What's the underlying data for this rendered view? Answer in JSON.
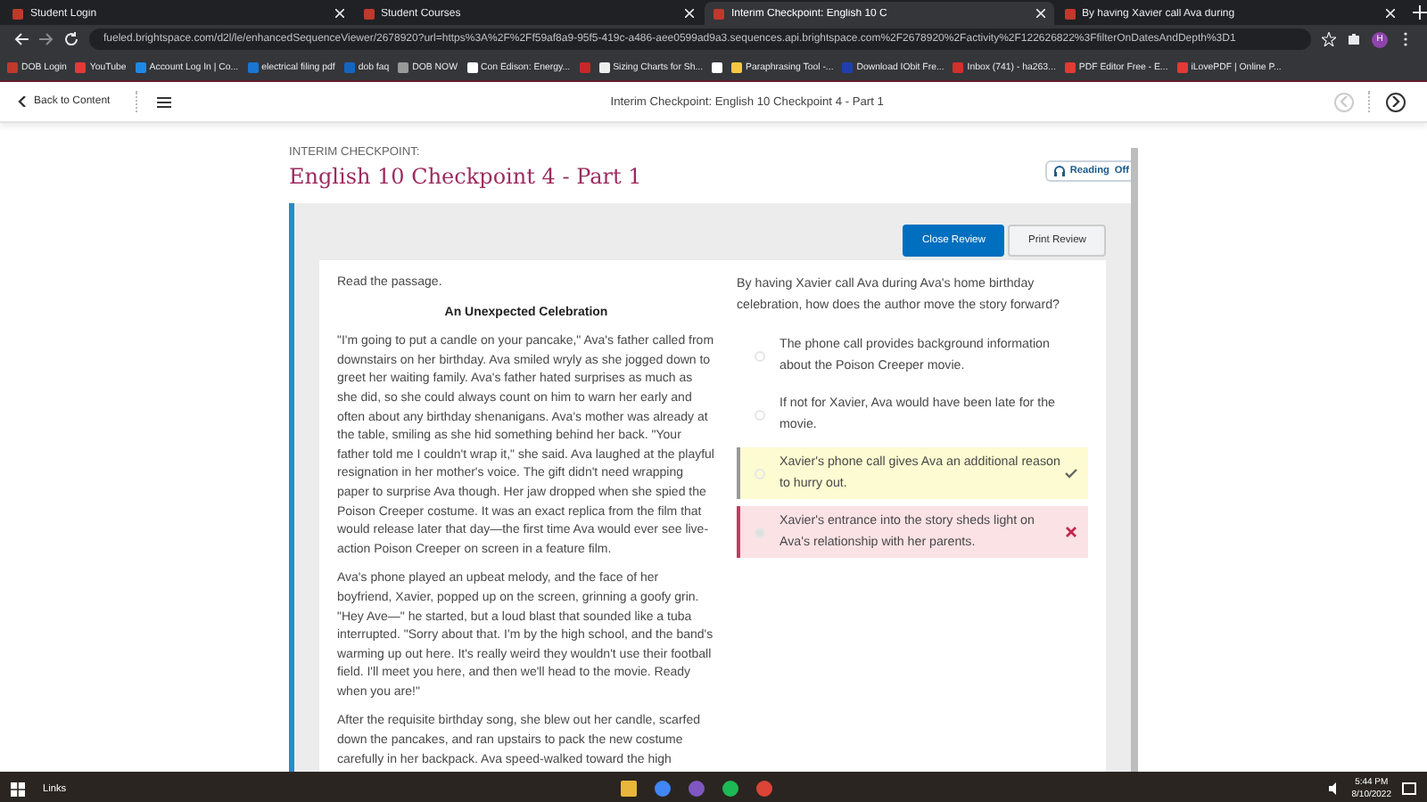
{
  "browser": {
    "tabs": [
      {
        "title": "Student Login",
        "selected": false
      },
      {
        "title": "Student Courses",
        "selected": false
      },
      {
        "title": "Interim Checkpoint: English 10 C",
        "selected": true
      },
      {
        "title": "By having Xavier call Ava during",
        "selected": false
      }
    ],
    "url": "fueled.brightspace.com/d2l/le/enhancedSequenceViewer/2678920?url=https%3A%2F%2Ff59af8a9-95f5-419c-a486-aee0599ad9a3.sequences.api.brightspace.com%2F2678920%2Factivity%2F122626822%3FfilterOnDatesAndDepth%3D1",
    "profile_initial": "H",
    "bookmarks": [
      {
        "kind": "link",
        "label": "DOB Login"
      },
      {
        "kind": "link",
        "label": "YouTube"
      },
      {
        "kind": "link",
        "label": "Account Log In | Co..."
      },
      {
        "kind": "link",
        "label": "electrical filing pdf"
      },
      {
        "kind": "link",
        "label": "dob faq"
      },
      {
        "kind": "link",
        "label": "DOB NOW"
      },
      {
        "kind": "link",
        "label": "Con Edison: Energy..."
      },
      {
        "kind": "icon"
      },
      {
        "kind": "link",
        "label": "Sizing Charts for Sh..."
      },
      {
        "kind": "icon"
      },
      {
        "kind": "link",
        "label": "Paraphrasing Tool -..."
      },
      {
        "kind": "link",
        "label": "Download IObit Fre..."
      },
      {
        "kind": "link",
        "label": "Inbox (741) - ha263..."
      },
      {
        "kind": "link",
        "label": "PDF Editor Free - E..."
      },
      {
        "kind": "link",
        "label": "iLovePDF | Online P..."
      }
    ]
  },
  "header": {
    "back": "Back to Content",
    "title": "Interim Checkpoint: English 10 Checkpoint 4 - Part 1"
  },
  "page": {
    "eyebrow": "INTERIM CHECKPOINT:",
    "title": "English 10 Checkpoint 4 - Part 1",
    "reading": {
      "label": "Reading",
      "state": "Off"
    },
    "buttons": [
      {
        "label": "Close Review",
        "kind": "primary"
      },
      {
        "label": "Print Review",
        "kind": "secondary"
      }
    ],
    "passage": {
      "instruction": "Read the passage.",
      "title": "An Unexpected Celebration",
      "paragraphs": [
        "\"I'm going to put a candle on your pancake,\" Ava's father called from downstairs on her birthday. Ava smiled wryly as she jogged down to greet her waiting family. Ava's father hated surprises as much as she did, so she could always count on him to warn her early and often about any birthday shenanigans. Ava's mother was already at the table, smiling as she hid something behind her back. \"Your father told me I couldn't wrap it,\" she said. Ava laughed at the playful resignation in her mother's voice. The gift didn't need wrapping paper to surprise Ava though. Her jaw dropped when she spied the Poison Creeper costume. It was an exact replica from the film that would release later that day—the first time Ava would ever see live-action Poison Creeper on screen in a feature film.",
        "Ava's phone played an upbeat melody, and the face of her boyfriend, Xavier, popped up on the screen, grinning a goofy grin. \"Hey Ave—\" he started, but a loud blast that sounded like a tuba interrupted. \"Sorry about that. I'm by the high school, and the band's warming up out here. It's really weird they wouldn't use their football field. I'll meet you here, and then we'll head to the movie. Ready when you are!\"",
        "After the requisite birthday song, she blew out her candle, scarfed down the pancakes, and ran upstairs to pack the new costume carefully in her backpack. Ava speed-walked toward the high"
      ]
    },
    "question": {
      "prompt": "By having Xavier call Ava during Ava's home birthday celebration, how does the author move the story forward?",
      "choices": [
        {
          "text": "The phone call provides background information about the Poison Creeper movie.",
          "selected": false,
          "correct": false,
          "incorrect": false
        },
        {
          "text": "If not for Xavier, Ava would have been late for the movie.",
          "selected": false,
          "correct": false,
          "incorrect": false
        },
        {
          "text": "Xavier's phone call gives Ava an additional reason to hurry out.",
          "selected": false,
          "correct": true,
          "incorrect": false
        },
        {
          "text": "Xavier's entrance into the story sheds light on Ava's relationship with her parents.",
          "selected": true,
          "correct": false,
          "incorrect": true
        }
      ]
    }
  },
  "taskbar": {
    "search_label": "Links",
    "time": "5:44 PM",
    "date": "8/10/2022"
  }
}
